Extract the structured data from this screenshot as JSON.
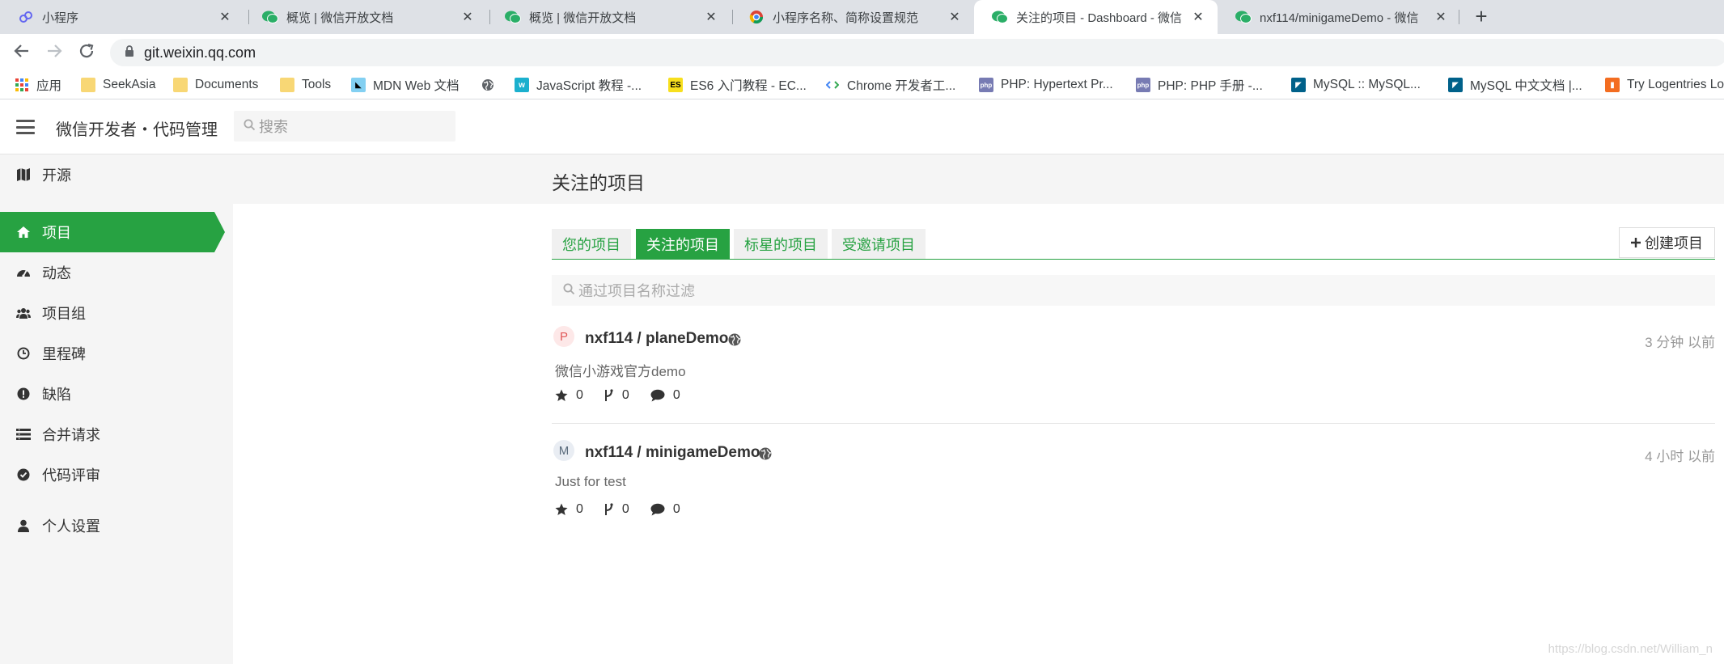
{
  "browser": {
    "tabs": [
      {
        "title": "小程序",
        "icon": "miniprogram-icon",
        "active": false
      },
      {
        "title": "概览 | 微信开放文档",
        "icon": "wechat-icon",
        "active": false
      },
      {
        "title": "概览 | 微信开放文档",
        "icon": "wechat-icon",
        "active": false
      },
      {
        "title": "小程序名称、简称设置规范",
        "icon": "chrome-icon",
        "active": false
      },
      {
        "title": "关注的项目 - Dashboard - 微信",
        "icon": "wechat-icon",
        "active": true
      },
      {
        "title": "nxf114/minigameDemo - 微信",
        "icon": "wechat-icon",
        "active": false
      }
    ],
    "new_tab_label": "+",
    "address": "git.weixin.qq.com",
    "bookmarks": [
      {
        "label": "应用",
        "icon": "apps-grid-icon"
      },
      {
        "label": "SeekAsia",
        "icon": "folder-icon"
      },
      {
        "label": "Documents",
        "icon": "folder-icon"
      },
      {
        "label": "Tools",
        "icon": "folder-icon"
      },
      {
        "label": "MDN Web 文档",
        "icon": "mdn-icon"
      },
      {
        "label": "",
        "icon": "globe-icon"
      },
      {
        "label": "JavaScript 教程 -...",
        "icon": "w3school-icon"
      },
      {
        "label": "ES6 入门教程 - EC...",
        "icon": "es6-icon"
      },
      {
        "label": "Chrome 开发者工...",
        "icon": "chrome-devtools-icon"
      },
      {
        "label": "PHP: Hypertext Pr...",
        "icon": "php-icon"
      },
      {
        "label": "PHP: PHP 手册 -...",
        "icon": "php-icon"
      },
      {
        "label": "MySQL :: MySQL...",
        "icon": "mysql-icon"
      },
      {
        "label": "MySQL 中文文档 |...",
        "icon": "mysql-icon"
      },
      {
        "label": "Try Logentries Lo",
        "icon": "logentries-icon"
      }
    ]
  },
  "header": {
    "title": "微信开发者・代码管理",
    "search_placeholder": "搜索"
  },
  "sidebar": {
    "items": [
      {
        "label": "开源",
        "icon": "map-icon"
      },
      {
        "label": "项目",
        "icon": "home-icon",
        "active": true
      },
      {
        "label": "动态",
        "icon": "dashboard-icon"
      },
      {
        "label": "项目组",
        "icon": "users-icon"
      },
      {
        "label": "里程碑",
        "icon": "clock-icon"
      },
      {
        "label": "缺陷",
        "icon": "exclamation-icon"
      },
      {
        "label": "合并请求",
        "icon": "list-icon"
      },
      {
        "label": "代码评审",
        "icon": "check-circle-icon"
      },
      {
        "label": "个人设置",
        "icon": "user-icon"
      }
    ]
  },
  "main": {
    "title": "关注的项目",
    "tabs": [
      {
        "label": "您的项目",
        "active": false
      },
      {
        "label": "关注的项目",
        "active": true
      },
      {
        "label": "标星的项目",
        "active": false
      },
      {
        "label": "受邀请项目",
        "active": false
      }
    ],
    "create_button": "创建项目",
    "filter_placeholder": "通过项目名称过滤",
    "projects": [
      {
        "avatar_letter": "P",
        "name": "nxf114 / planeDemo",
        "description": "微信小游戏官方demo",
        "time": "3 分钟 以前",
        "stars": "0",
        "forks": "0",
        "comments": "0"
      },
      {
        "avatar_letter": "M",
        "name": "nxf114 / minigameDemo",
        "description": "Just for test",
        "time": "4 小时 以前",
        "stars": "0",
        "forks": "0",
        "comments": "0"
      }
    ]
  },
  "watermark": "https://blog.csdn.net/William_n",
  "colors": {
    "accent": "#27a242",
    "sidebar_bg": "#f5f5f5",
    "tabstrip_bg": "#dee1e6"
  }
}
